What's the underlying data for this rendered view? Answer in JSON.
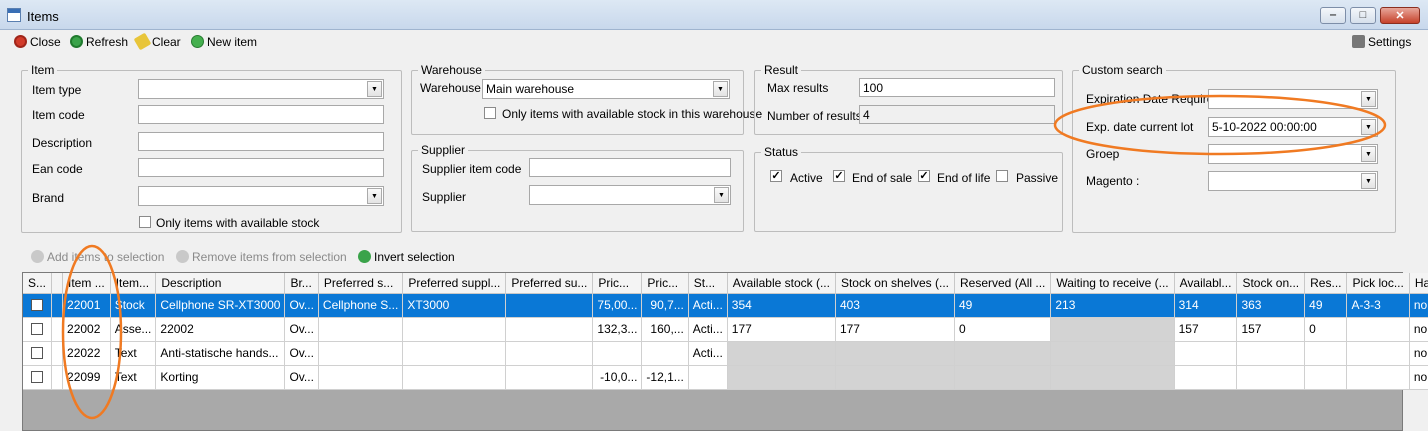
{
  "window": {
    "title": "Items",
    "minimize_glyph": "‒",
    "maximize_glyph": "□",
    "close_glyph": "✕"
  },
  "toolbar": {
    "close_label": "Close",
    "refresh_label": "Refresh",
    "clear_label": "Clear",
    "new_item_label": "New item",
    "settings_label": "Settings"
  },
  "item": {
    "legend": "Item",
    "item_type_label": "Item type",
    "item_type_value": "",
    "item_code_label": "Item code",
    "item_code_value": "",
    "description_label": "Description",
    "description_value": "",
    "ean_label": "Ean code",
    "ean_value": "",
    "brand_label": "Brand",
    "brand_value": "",
    "stock_only_label": "Only items with available stock"
  },
  "warehouse": {
    "legend": "Warehouse",
    "warehouse_label": "Warehouse",
    "warehouse_value": "Main warehouse",
    "stock_only_label": "Only items with available stock in this warehouse"
  },
  "supplier": {
    "legend": "Supplier",
    "supplier_item_code_label": "Supplier item code",
    "supplier_item_code_value": "",
    "supplier_label": "Supplier",
    "supplier_value": ""
  },
  "result": {
    "legend": "Result",
    "max_results_label": "Max results",
    "max_results_value": "100",
    "number_label": "Number of results",
    "number_value": "4"
  },
  "status": {
    "legend": "Status",
    "check_glyph": "✓",
    "active_label": "Active",
    "active_checked": true,
    "end_of_sale_label": "End of sale",
    "end_of_sale_checked": true,
    "end_of_life_label": "End of life",
    "end_of_life_checked": true,
    "passive_label": "Passive",
    "passive_checked": false
  },
  "custom": {
    "legend": "Custom search",
    "exp_req_label": "Expiration Date Required",
    "exp_req_value": "",
    "exp_lot_label": "Exp. date current lot",
    "exp_lot_value": "5-10-2022 00:00:00",
    "groep_label": "Groep",
    "groep_value": "",
    "magento_label": "Magento :",
    "magento_value": ""
  },
  "selection": {
    "add_label": "Add items to selection",
    "remove_label": "Remove items from selection",
    "invert_label": "Invert selection"
  },
  "grid": {
    "headers": [
      "S...",
      "Item ...",
      "Item...",
      "Description",
      "Br...",
      "Preferred s...",
      "Preferred suppl...",
      "Preferred su...",
      "Pric...",
      "Pric...",
      "St...",
      "Available stock (...",
      "Stock on shelves (...",
      "Reserved (All ...",
      "Waiting to receive (...",
      "Availabl...",
      "Stock on...",
      "Res...",
      "Pick loc...",
      "Has r..."
    ],
    "rows": [
      [
        "",
        "22001",
        "Stock",
        "Cellphone SR-XT3000",
        "Ov...",
        "Cellphone S...",
        "XT3000",
        "",
        "75,00...",
        "90,7...",
        "Acti...",
        "354",
        "403",
        "49",
        "213",
        "314",
        "363",
        "49",
        "A-3-3",
        "no"
      ],
      [
        "",
        "22002",
        "Asse...",
        "22002",
        "Ov...",
        "",
        "",
        "",
        "132,3...",
        "160,...",
        "Acti...",
        "177",
        "177",
        "0",
        "",
        "157",
        "157",
        "0",
        "",
        "no"
      ],
      [
        "",
        "22022",
        "Text",
        "Anti-statische hands...",
        "Ov...",
        "",
        "",
        "",
        "",
        "",
        "Acti...",
        "",
        "",
        "",
        "",
        "",
        "",
        "",
        "",
        "no"
      ],
      [
        "",
        "22099",
        "Text",
        "Korting",
        "Ov...",
        "",
        "",
        "",
        "-10,0...",
        "-12,1...",
        "",
        "",
        "",
        "",
        "",
        "",
        "",
        "",
        "",
        "no"
      ]
    ]
  },
  "colors": {
    "selection": "#0a78d6",
    "annotation": "#f07a22"
  }
}
